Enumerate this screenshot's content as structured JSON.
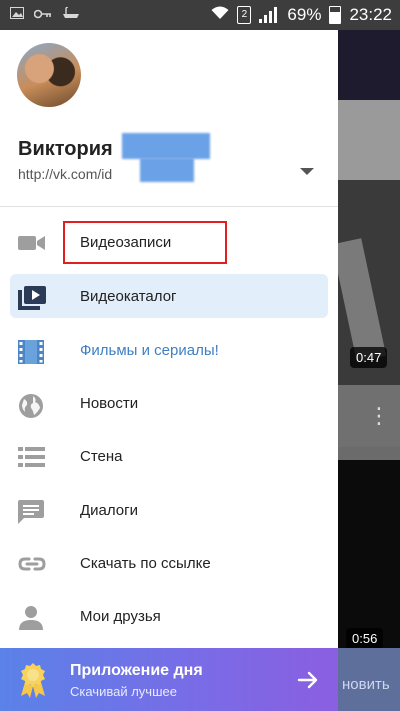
{
  "status_bar": {
    "battery_percent": "69%",
    "time": "23:22",
    "sim_label": "2",
    "icons": [
      "gallery-icon",
      "key-icon",
      "bath-icon",
      "wifi-icon",
      "sim-icon",
      "signal-icon",
      "battery-icon"
    ]
  },
  "profile": {
    "name": "Виктория",
    "url": "http://vk.com/id"
  },
  "menu": {
    "items": [
      {
        "label": "Видеозаписи",
        "icon": "video-camera-icon"
      },
      {
        "label": "Видеокаталог",
        "icon": "video-catalog-icon",
        "active": true
      },
      {
        "label": "Фильмы и сериалы!",
        "icon": "film-strip-icon",
        "color": "#3f7fc4"
      },
      {
        "label": "Новости",
        "icon": "globe-icon"
      },
      {
        "label": "Стена",
        "icon": "list-icon"
      },
      {
        "label": "Диалоги",
        "icon": "chat-icon"
      },
      {
        "label": "Скачать по ссылке",
        "icon": "link-icon"
      },
      {
        "label": "Мои друзья",
        "icon": "person-icon"
      }
    ]
  },
  "promo": {
    "title": "Приложение дня",
    "subtitle": "Скачивай лучшее",
    "icon": "award-ribbon-icon",
    "arrow_icon": "arrow-right-icon"
  },
  "background": {
    "durations": [
      "0:47",
      "0:56"
    ],
    "bottom_action": "новить"
  },
  "colors": {
    "accent": "#3f7fc4",
    "active_bg": "#e3eefb",
    "highlight_border": "#e02020",
    "promo_start": "#5a82e8",
    "promo_end": "#8a5fe0"
  }
}
